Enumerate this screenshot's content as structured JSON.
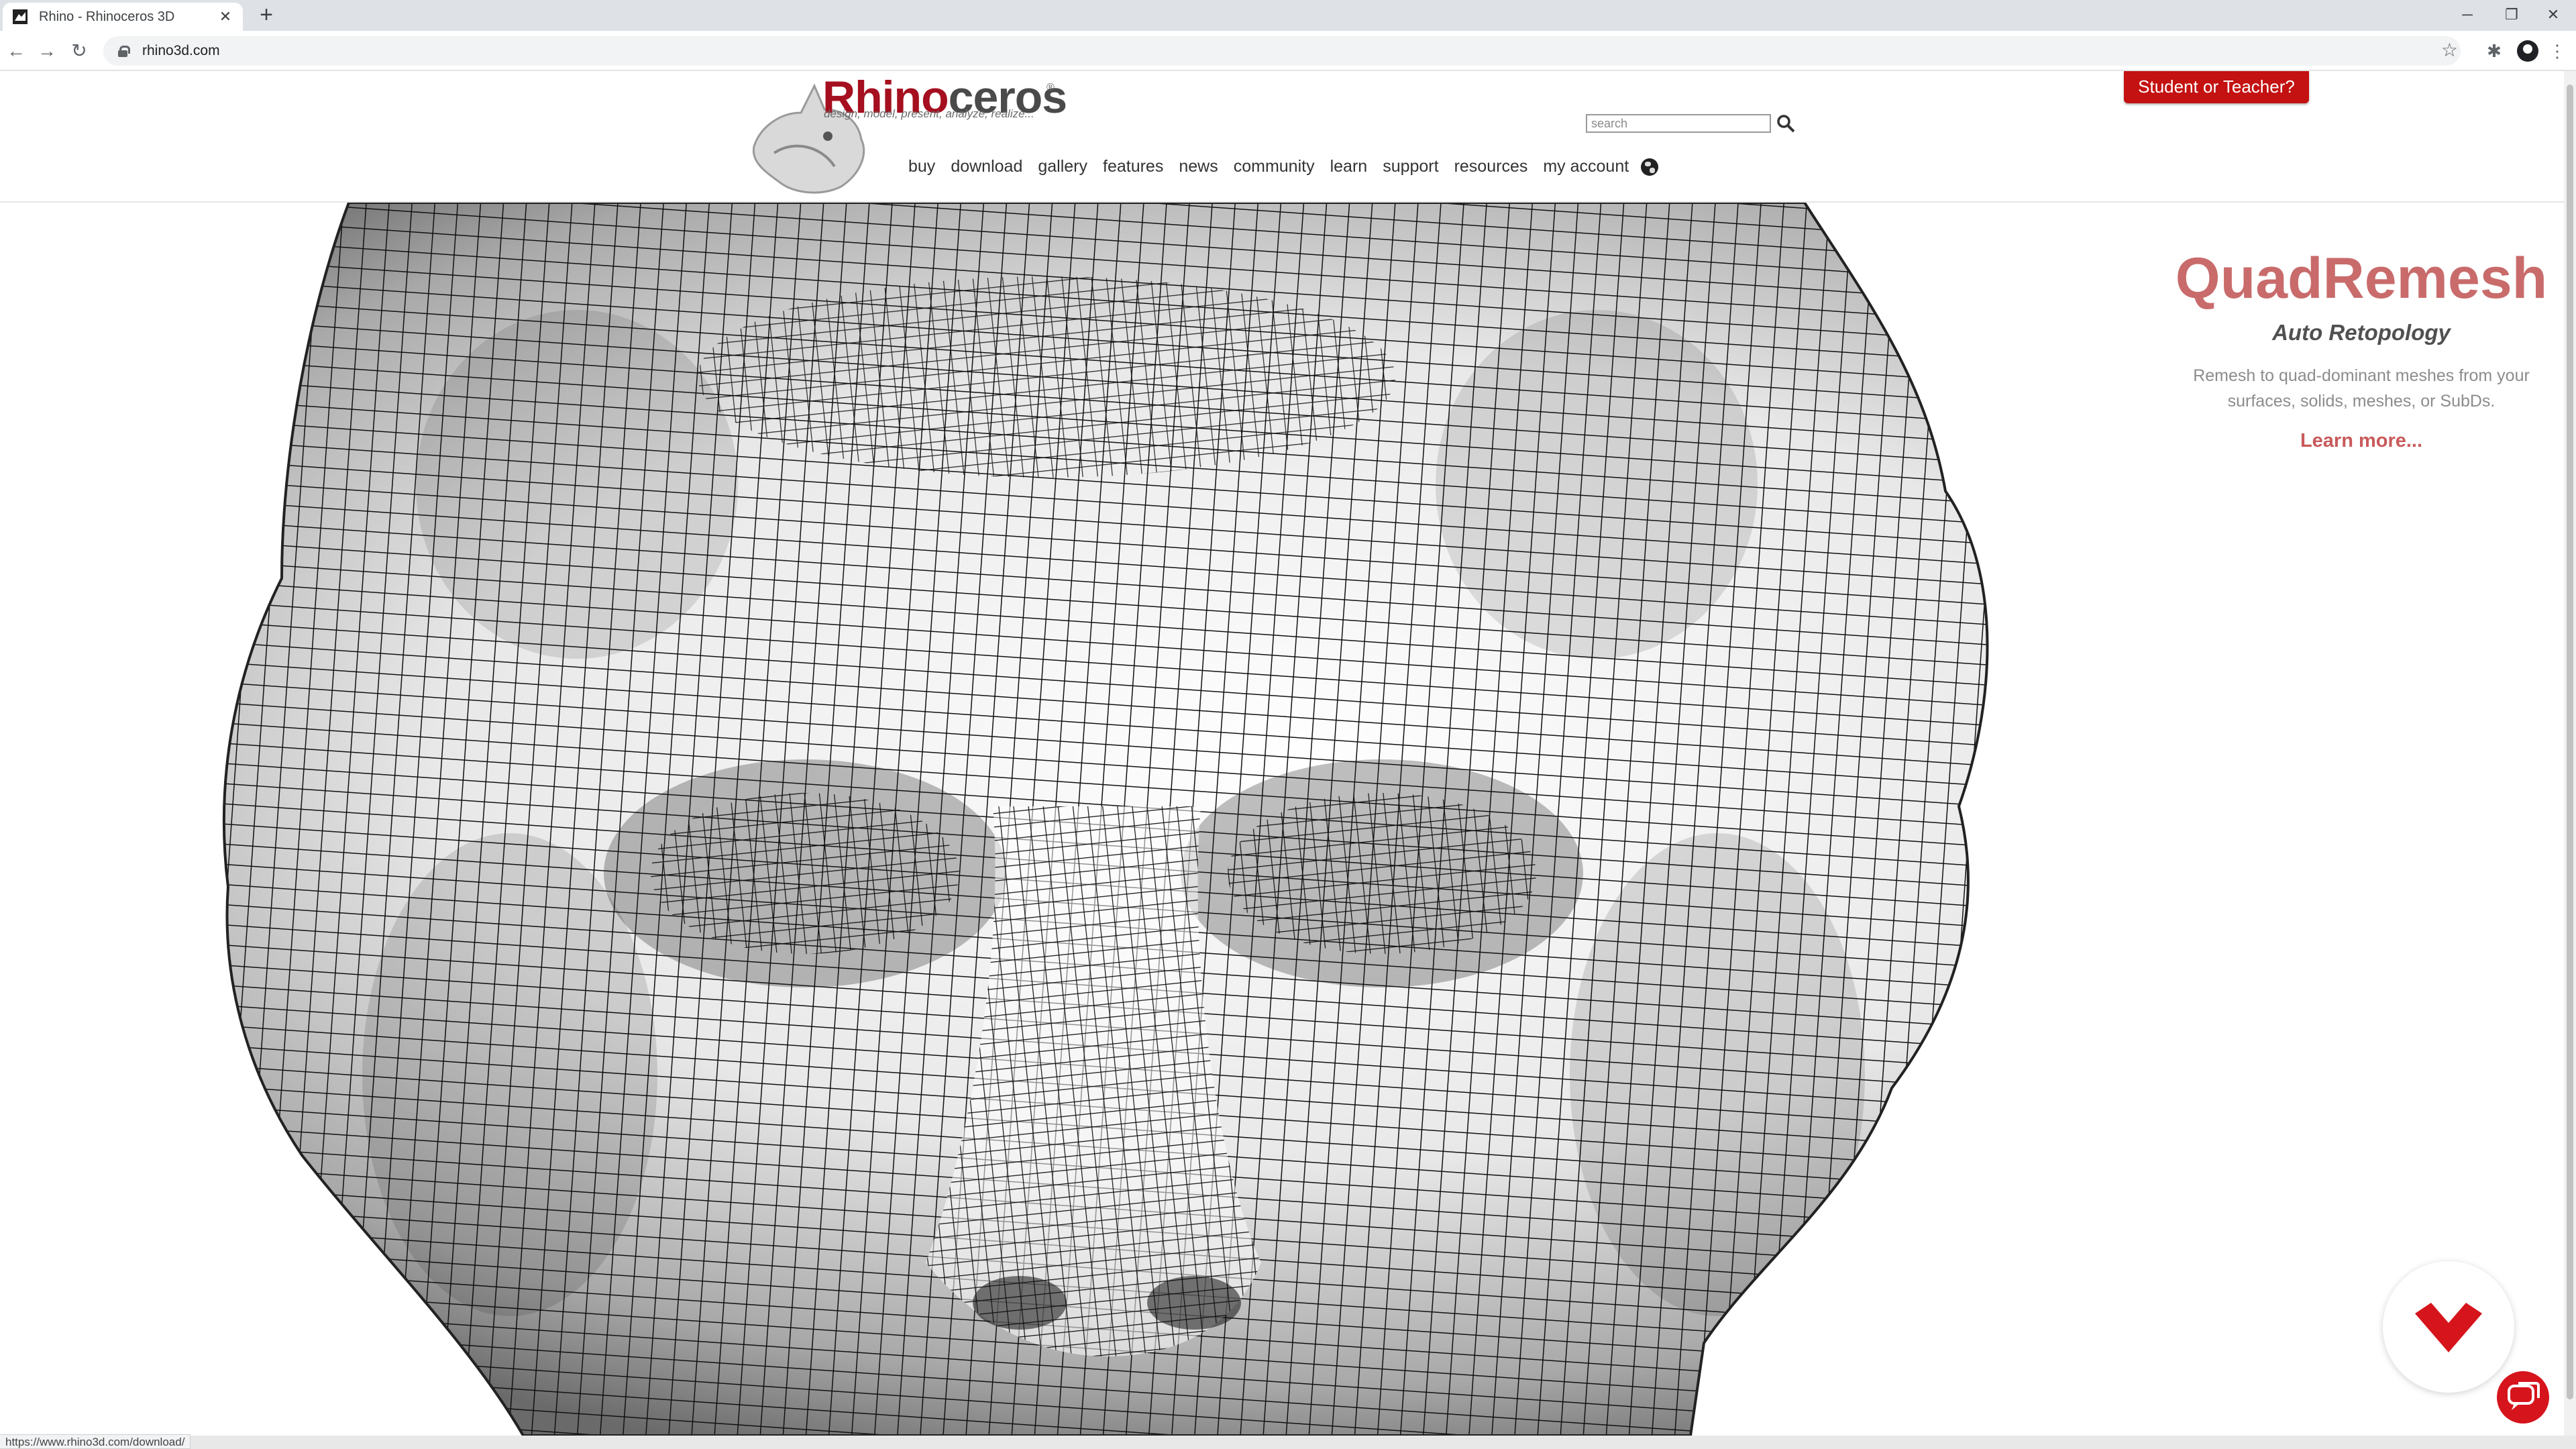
{
  "browser": {
    "tab_title": "Rhino - Rhinoceros 3D",
    "tab_close": "✕",
    "new_tab": "+",
    "url": "rhino3d.com",
    "window_controls": [
      "─",
      "❐",
      "✕"
    ],
    "back_icon": "←",
    "forward_icon": "→",
    "reload_icon": "↻",
    "star_icon": "☆",
    "extensions_icon": "✱",
    "menu_icon": "⋮"
  },
  "site": {
    "logo_part1": "Rhino",
    "logo_part2": "ceros",
    "logo_reg": "®",
    "logo_tagline": "design, model, present, analyze, realize...",
    "search_placeholder": "search",
    "student_button": "Student or Teacher?",
    "nav": [
      "buy",
      "download",
      "gallery",
      "features",
      "news",
      "community",
      "learn",
      "support",
      "resources",
      "my account"
    ]
  },
  "promo": {
    "title": "QuadRemesh",
    "subtitle": "Auto Retopology",
    "description": "Remesh to quad-dominant meshes from your surfaces, solids, meshes, or SubDs.",
    "link": "Learn more..."
  },
  "status_bar": {
    "hover_url": "https://www.rhino3d.com/download/"
  },
  "colors": {
    "brand_red": "#a50f1f",
    "button_red": "#c41111",
    "promo_title": "#c96b6b"
  }
}
